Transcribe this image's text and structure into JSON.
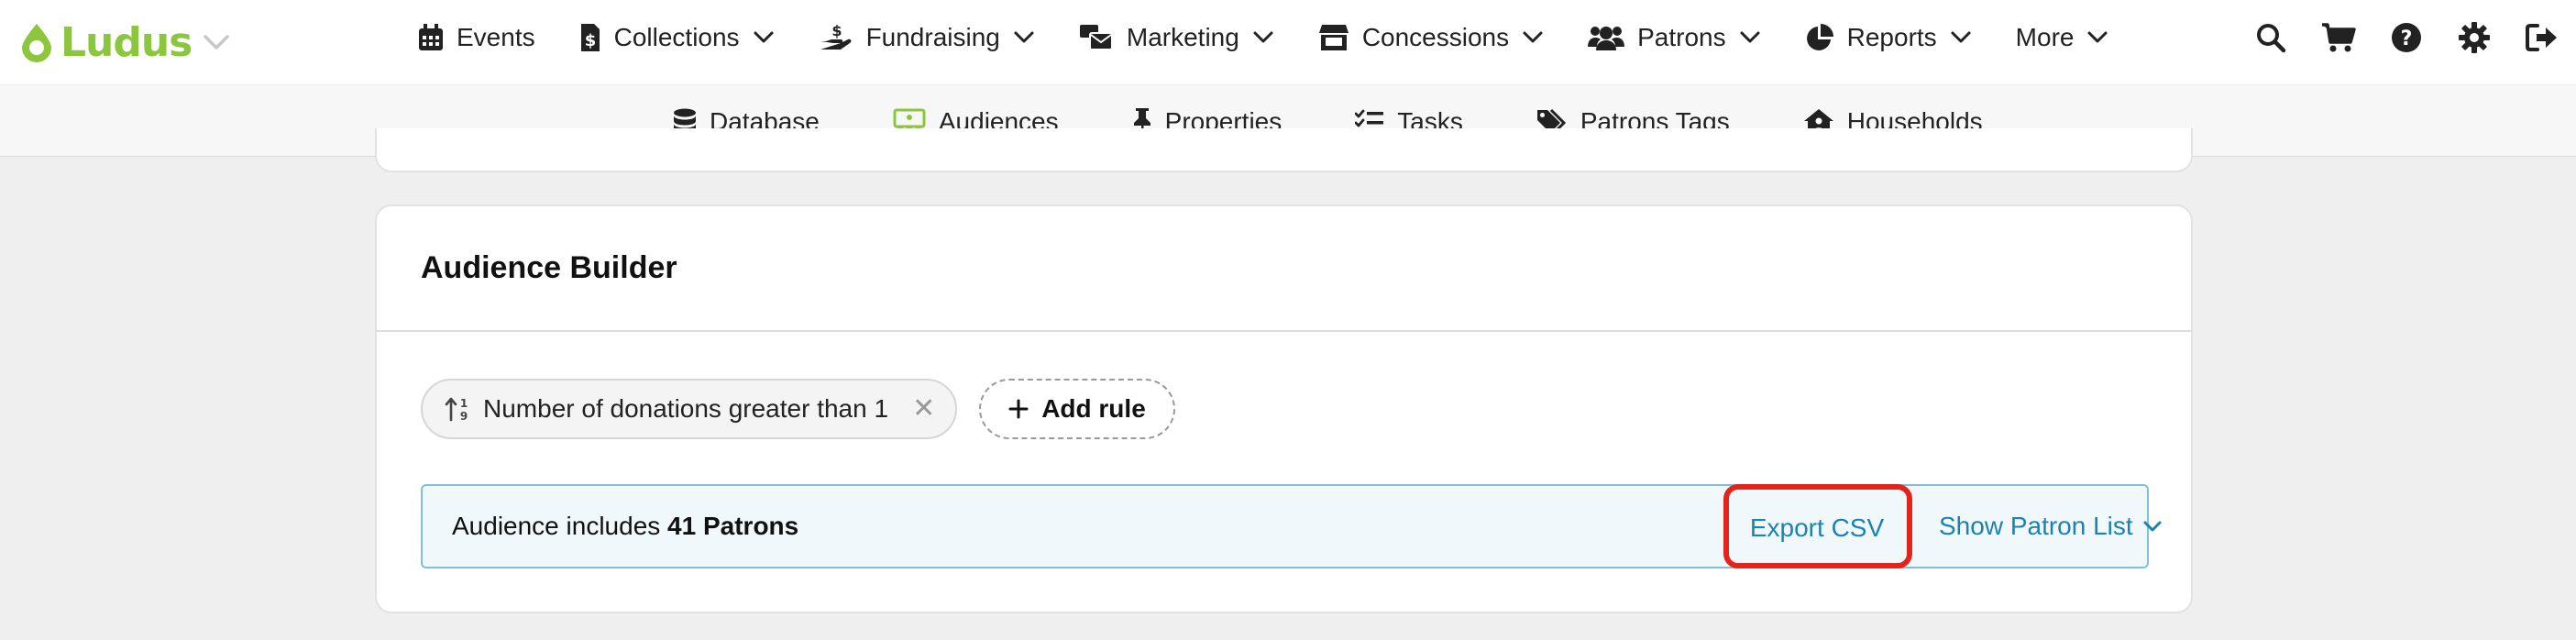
{
  "brand": {
    "name": "Ludus",
    "color": "#8cc63f"
  },
  "nav": {
    "items": [
      {
        "label": "Events",
        "icon": "calendar-icon",
        "dropdown": false
      },
      {
        "label": "Collections",
        "icon": "dollar-file-icon",
        "dropdown": true
      },
      {
        "label": "Fundraising",
        "icon": "hand-holding-dollar-icon",
        "dropdown": true
      },
      {
        "label": "Marketing",
        "icon": "mail-bulk-icon",
        "dropdown": true
      },
      {
        "label": "Concessions",
        "icon": "store-icon",
        "dropdown": true
      },
      {
        "label": "Patrons",
        "icon": "users-icon",
        "dropdown": true
      },
      {
        "label": "Reports",
        "icon": "pie-chart-icon",
        "dropdown": true
      },
      {
        "label": "More",
        "icon": "",
        "dropdown": true
      }
    ],
    "utilities": [
      "search-icon",
      "cart-icon",
      "help-icon",
      "gear-icon",
      "sign-out-icon"
    ]
  },
  "subnav": {
    "items": [
      {
        "label": "Database",
        "icon": "database-icon",
        "active": false
      },
      {
        "label": "Audiences",
        "icon": "audience-icon",
        "active": true
      },
      {
        "label": "Properties",
        "icon": "pushpin-icon",
        "active": false
      },
      {
        "label": "Tasks",
        "icon": "task-list-icon",
        "active": false
      },
      {
        "label": "Patrons Tags",
        "icon": "tags-icon",
        "active": false
      },
      {
        "label": "Households",
        "icon": "house-user-icon",
        "active": false
      }
    ],
    "active_color": "#8cc63f"
  },
  "builder": {
    "title": "Audience Builder",
    "rules": [
      {
        "label": "Number of donations greater than 1",
        "icon": "sort-numeric-icon"
      }
    ],
    "add_rule_label": "Add rule",
    "summary": {
      "prefix": "Audience includes ",
      "count": "41 Patrons",
      "export_label": "Export CSV",
      "show_list_label": "Show Patron List"
    },
    "link_color": "#1b82b3",
    "highlight_color": "#e3241c"
  }
}
